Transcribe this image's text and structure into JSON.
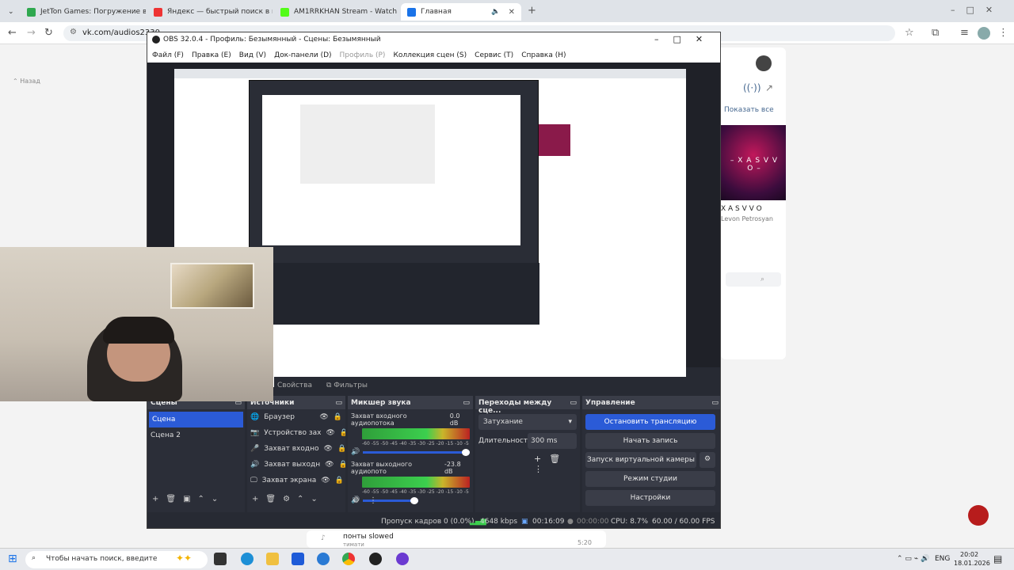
{
  "browser": {
    "tabs": [
      {
        "label": "JetTon Games: Погружение в и",
        "color": "#2fa84f"
      },
      {
        "label": "Яндекс — быстрый поиск в ин",
        "color": "#e33"
      },
      {
        "label": "AM1RRKHAN Stream - Watch L",
        "color": "#53fc18"
      },
      {
        "label": "Главная",
        "color": "#1a73e8"
      }
    ],
    "url": "vk.com/audios2330",
    "back_icon": "back-arrow-icon",
    "forward_icon": "forward-arrow-icon"
  },
  "page": {
    "back_label": "Назад",
    "show_all": "Показать все",
    "artist_name": "X A S V V O",
    "artist_sub": "Levon Petrosyan",
    "song_title": "понты slowed",
    "song_sub": "тимати",
    "song_time": "5:20"
  },
  "obs": {
    "title": "OBS 32.0.4 - Профиль: Безымянный - Сцены: Безымянный",
    "menu": [
      "Файл (F)",
      "Правка (E)",
      "Вид (V)",
      "Док-панели (D)",
      "Профиль (P)",
      "Коллекция сцен (S)",
      "Сервис (T)",
      "Справка (H)"
    ],
    "props_label": "Свойства",
    "filters_label": "Фильтры",
    "scenes": {
      "title": "Сцены",
      "items": [
        "Сцена",
        "Сцена 2"
      ]
    },
    "sources": {
      "title": "Источники",
      "items": [
        "Браузер",
        "Устройство зах",
        "Захват входно",
        "Захват выходн",
        "Захват экрана"
      ]
    },
    "mixer": {
      "title": "Микшер звука",
      "tracks": [
        {
          "name": "Захват входного аудиопотока",
          "db": "0.0 dB"
        },
        {
          "name": "Захват выходного аудиопото",
          "db": "-23.8 dB"
        }
      ],
      "scale": "-60 -55 -50 -45 -40 -35 -30 -25 -20 -15 -10 -5 0"
    },
    "transitions": {
      "title": "Переходы между сце...",
      "type": "Затухание",
      "duration_label": "Длительность",
      "duration_value": "300 ms"
    },
    "controls": {
      "title": "Управление",
      "stop_stream": "Остановить трансляцию",
      "start_record": "Начать запись",
      "virtual_cam": "Запуск виртуальной камеры",
      "studio_mode": "Режим студии",
      "settings": "Настройки"
    },
    "status": {
      "dropped": "Пропуск кадров 0 (0.0%)",
      "bitrate": "4648 kbps",
      "stream_time": "00:16:09",
      "rec_time": "00:00:00",
      "cpu": "CPU: 8.7%",
      "fps": "60.00 / 60.00 FPS"
    }
  },
  "taskbar": {
    "search_placeholder": "Чтобы начать поиск, введите",
    "lang": "ENG",
    "time": "20:02",
    "date": "18.01.2026"
  }
}
